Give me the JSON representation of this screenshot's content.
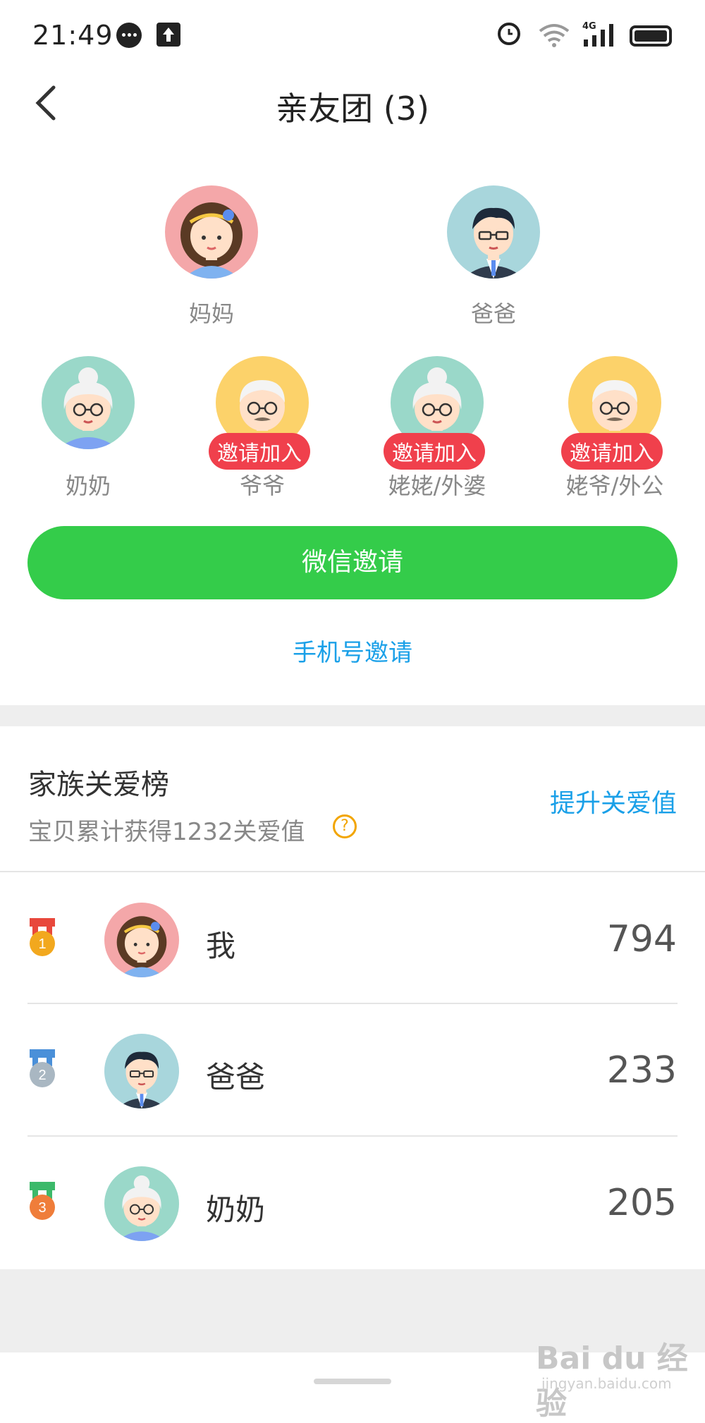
{
  "status": {
    "time": "21:49",
    "network": "4G"
  },
  "header": {
    "title": "亲友团 (3)"
  },
  "members_top": [
    {
      "name": "妈妈",
      "avatar": "mom-avatar"
    },
    {
      "name": "爸爸",
      "avatar": "dad-avatar"
    }
  ],
  "members_bottom": [
    {
      "name": "奶奶",
      "avatar": "grandma-avatar"
    },
    {
      "name": "爷爷",
      "avatar": "grandpa-avatar",
      "badge": "邀请加入"
    },
    {
      "name": "姥姥/外婆",
      "avatar": "grandma-avatar",
      "badge": "邀请加入"
    },
    {
      "name": "姥爷/外公",
      "avatar": "grandpa-avatar",
      "badge": "邀请加入"
    }
  ],
  "actions": {
    "wechat_label": "微信邀请",
    "phone_label": "手机号邀请"
  },
  "ranking": {
    "title": "家族关爱榜",
    "subtitle": "宝贝累计获得1232关爱值",
    "help_icon": "?",
    "improve_label": "提升关爱值",
    "rows": [
      {
        "rank": "1",
        "name": "我",
        "score": "794",
        "avatar": "mom-avatar",
        "medal_color": "#f2a81e"
      },
      {
        "rank": "2",
        "name": "爸爸",
        "score": "233",
        "avatar": "dad-avatar",
        "medal_color": "#a9b7c2"
      },
      {
        "rank": "3",
        "name": "奶奶",
        "score": "205",
        "avatar": "grandma-avatar",
        "medal_color": "#ef7d3a"
      }
    ]
  },
  "watermark": {
    "text": "Bai du 经验",
    "sub": "jingyan.baidu.com"
  },
  "colors": {
    "accent_green": "#34cc4a",
    "link_blue": "#1aa0e8",
    "badge_red": "#f0404c"
  }
}
